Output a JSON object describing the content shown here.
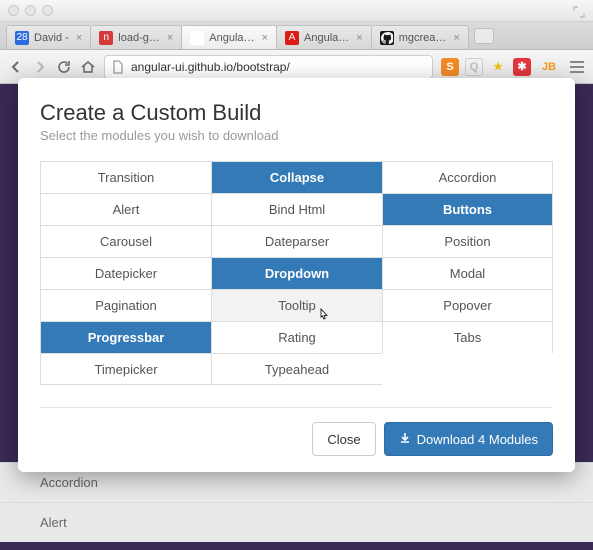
{
  "browser": {
    "tabs": [
      {
        "favicon_bg": "#2d6cdf",
        "favicon_fg": "#ffffff",
        "favicon_text": "28",
        "label": "David -"
      },
      {
        "favicon_bg": "#d63a3a",
        "favicon_fg": "#ffffff",
        "favicon_text": "n",
        "label": "load-g…"
      },
      {
        "favicon_bg": "#ffffff",
        "favicon_fg": "#888888",
        "favicon_text": "",
        "label": "Angula…",
        "active": true
      },
      {
        "favicon_bg": "#dd1b16",
        "favicon_fg": "#ffffff",
        "favicon_text": "A",
        "label": "Angula…"
      },
      {
        "favicon_bg": "#181818",
        "favicon_fg": "#ffffff",
        "favicon_text": "",
        "label": "mgcrea…",
        "github": true
      }
    ],
    "url": "angular-ui.github.io/bootstrap/",
    "extensions": [
      {
        "bg": "#f28b24",
        "fg": "#ffffff",
        "text": "S"
      },
      {
        "bg": "transparent",
        "fg": "#bfbfbf",
        "text": "Q",
        "outline": true
      },
      {
        "bg": "transparent",
        "fg": "#f0c419",
        "text": "★"
      },
      {
        "bg": "#e2373e",
        "fg": "#ffffff",
        "text": "✱"
      },
      {
        "bg": "transparent",
        "fg": "#f89a1c",
        "text": "JB",
        "wide": true
      }
    ]
  },
  "page_behind": {
    "item1": "Accordion",
    "item2": "Alert"
  },
  "modal": {
    "title": "Create a Custom Build",
    "subtitle": "Select the modules you wish to download",
    "modules": [
      {
        "label": "Transition",
        "selected": false
      },
      {
        "label": "Collapse",
        "selected": true
      },
      {
        "label": "Accordion",
        "selected": false
      },
      {
        "label": "Alert",
        "selected": false
      },
      {
        "label": "Bind Html",
        "selected": false
      },
      {
        "label": "Buttons",
        "selected": true
      },
      {
        "label": "Carousel",
        "selected": false
      },
      {
        "label": "Dateparser",
        "selected": false
      },
      {
        "label": "Position",
        "selected": false
      },
      {
        "label": "Datepicker",
        "selected": false
      },
      {
        "label": "Dropdown",
        "selected": true
      },
      {
        "label": "Modal",
        "selected": false
      },
      {
        "label": "Pagination",
        "selected": false
      },
      {
        "label": "Tooltip",
        "selected": false,
        "hover": true
      },
      {
        "label": "Popover",
        "selected": false
      },
      {
        "label": "Progressbar",
        "selected": true
      },
      {
        "label": "Rating",
        "selected": false
      },
      {
        "label": "Tabs",
        "selected": false
      },
      {
        "label": "Timepicker",
        "selected": false
      },
      {
        "label": "Typeahead",
        "selected": false
      }
    ],
    "selected_count": 4,
    "close_label": "Close",
    "download_label": "Download 4 Modules"
  }
}
